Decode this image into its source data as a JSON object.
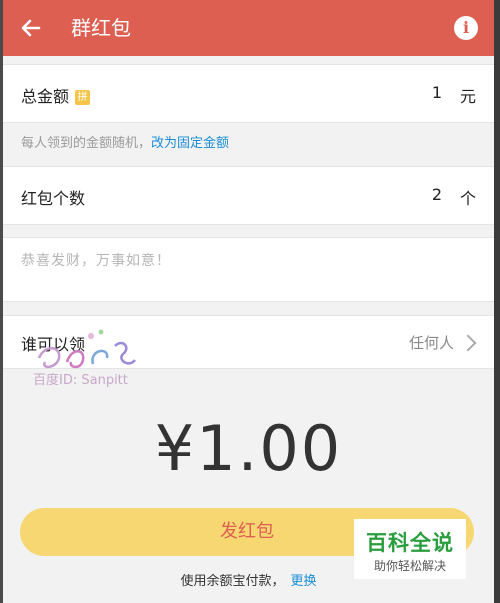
{
  "header": {
    "title": "群红包",
    "info_label": "i"
  },
  "total_amount": {
    "label": "总金额",
    "pin_badge": "拼",
    "value": "1",
    "unit": "元"
  },
  "hint": {
    "text": "每人领到的金额随机，",
    "link": "改为固定金额"
  },
  "packet_count": {
    "label": "红包个数",
    "value": "2",
    "unit": "个"
  },
  "greeting": {
    "placeholder": "恭喜发财，万事如意！"
  },
  "who_can_claim": {
    "label": "谁可以领",
    "value": "任何人"
  },
  "watermark": {
    "text": "百度ID: Sanpitt"
  },
  "amount_display": "¥1.00",
  "send_button": "发红包",
  "payment": {
    "text": "使用余额宝付款，",
    "change": "更换"
  },
  "corner_badge": {
    "title": "百科全说",
    "subtitle": "助你轻松解决"
  },
  "colors": {
    "header": "#dd5f52",
    "button": "#f7d772",
    "link": "#1a8dd8",
    "badge_green": "#2a9e3e"
  }
}
